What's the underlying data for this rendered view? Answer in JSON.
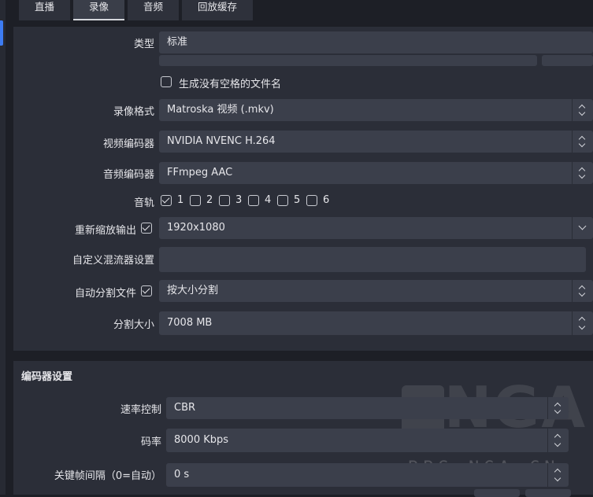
{
  "tabs": [
    {
      "label": "直播"
    },
    {
      "label": "录像",
      "active": true
    },
    {
      "label": "音频"
    },
    {
      "label": "回放缓存"
    }
  ],
  "recording": {
    "type_label": "类型",
    "type_value": "标准",
    "no_space_label": "生成没有空格的文件名",
    "format_label": "录像格式",
    "format_value": "Matroska 视频 (.mkv)",
    "video_encoder_label": "视频编码器",
    "video_encoder_value": "NVIDIA NVENC H.264",
    "audio_encoder_label": "音频编码器",
    "audio_encoder_value": "FFmpeg AAC",
    "tracks_label": "音轨",
    "tracks": [
      {
        "label": "1",
        "checked": true
      },
      {
        "label": "2",
        "checked": false
      },
      {
        "label": "3",
        "checked": false
      },
      {
        "label": "4",
        "checked": false
      },
      {
        "label": "5",
        "checked": false
      },
      {
        "label": "6",
        "checked": false
      }
    ],
    "rescale_label": "重新缩放输出",
    "rescale_checked": true,
    "rescale_value": "1920x1080",
    "muxer_label": "自定义混流器设置",
    "muxer_value": "",
    "autosplit_label": "自动分割文件",
    "autosplit_checked": true,
    "autosplit_value": "按大小分割",
    "split_size_label": "分割大小",
    "split_size_value": "7008 MB"
  },
  "encoder": {
    "title": "编码器设置",
    "rate_control_label": "速率控制",
    "rate_control_value": "CBR",
    "bitrate_label": "码率",
    "bitrate_value": "8000 Kbps",
    "keyframe_label": "关键帧间隔（0=自动）",
    "keyframe_value": "0 s"
  },
  "watermark": {
    "logo_text": "NGA",
    "site_text": "BBS.NGA.CN"
  }
}
